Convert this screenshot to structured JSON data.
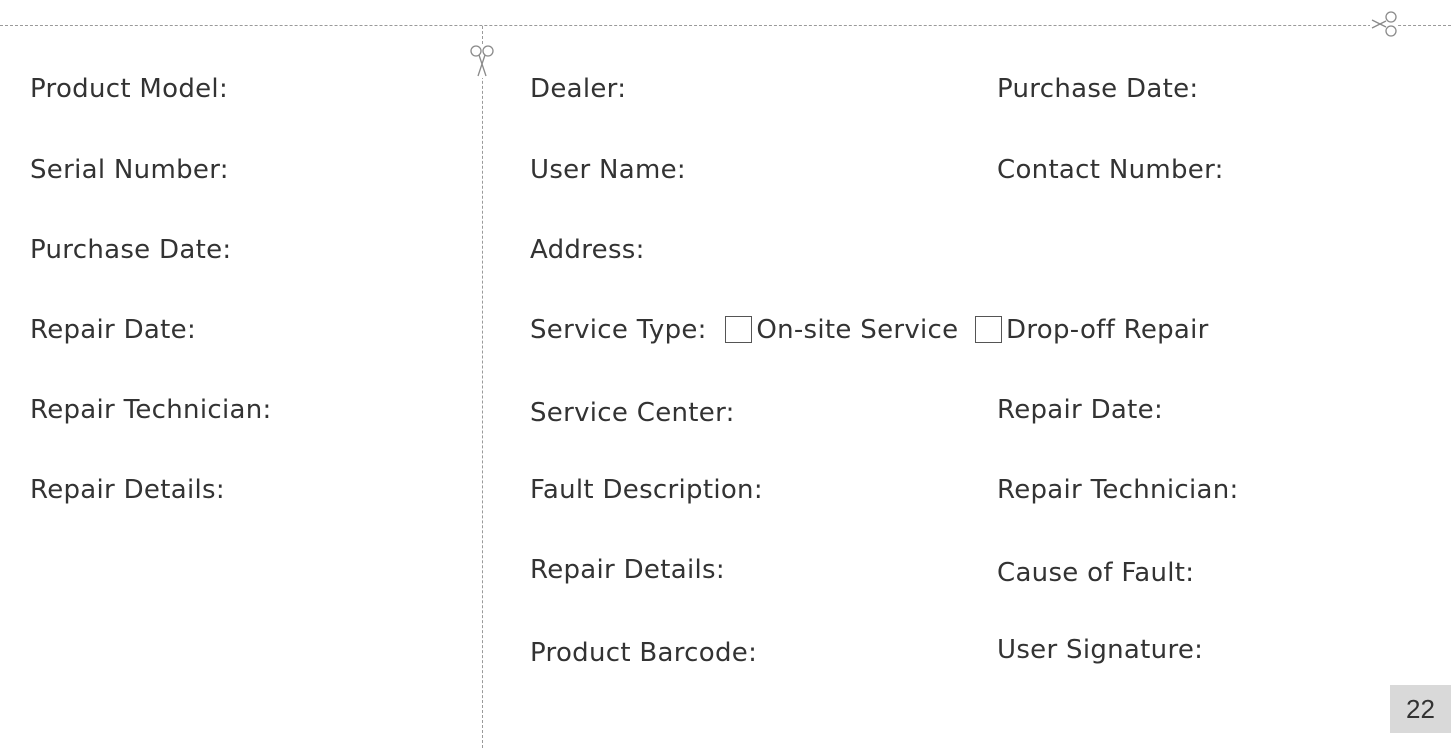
{
  "left_panel": {
    "fields": [
      "Product Model:",
      "Serial Number:",
      "Purchase Date:",
      "Repair Date:",
      "Repair Technician:",
      "Repair Details:"
    ]
  },
  "right_panel": {
    "dealer": "Dealer:",
    "purchase_date": "Purchase Date:",
    "user_name": "User Name:",
    "contact_number": "Contact Number:",
    "address": "Address:",
    "service_type": {
      "label": "Service Type:",
      "option_1": "On-site Service",
      "option_2": "Drop-off Repair"
    },
    "service_center": "Service Center:",
    "repair_date": "Repair Date:",
    "fault_description": "Fault Description:",
    "repair_technician": "Repair Technician:",
    "repair_details": "Repair Details:",
    "cause_of_fault": "Cause of Fault:",
    "product_barcode": "Product Barcode:",
    "user_signature": "User Signature:"
  },
  "page_number": "22",
  "icons": {
    "cut_marks": "scissors-icon"
  },
  "colors": {
    "text": "#333333",
    "cut_line": "#9a9a9a",
    "page_badge": "#d9d9d9"
  }
}
